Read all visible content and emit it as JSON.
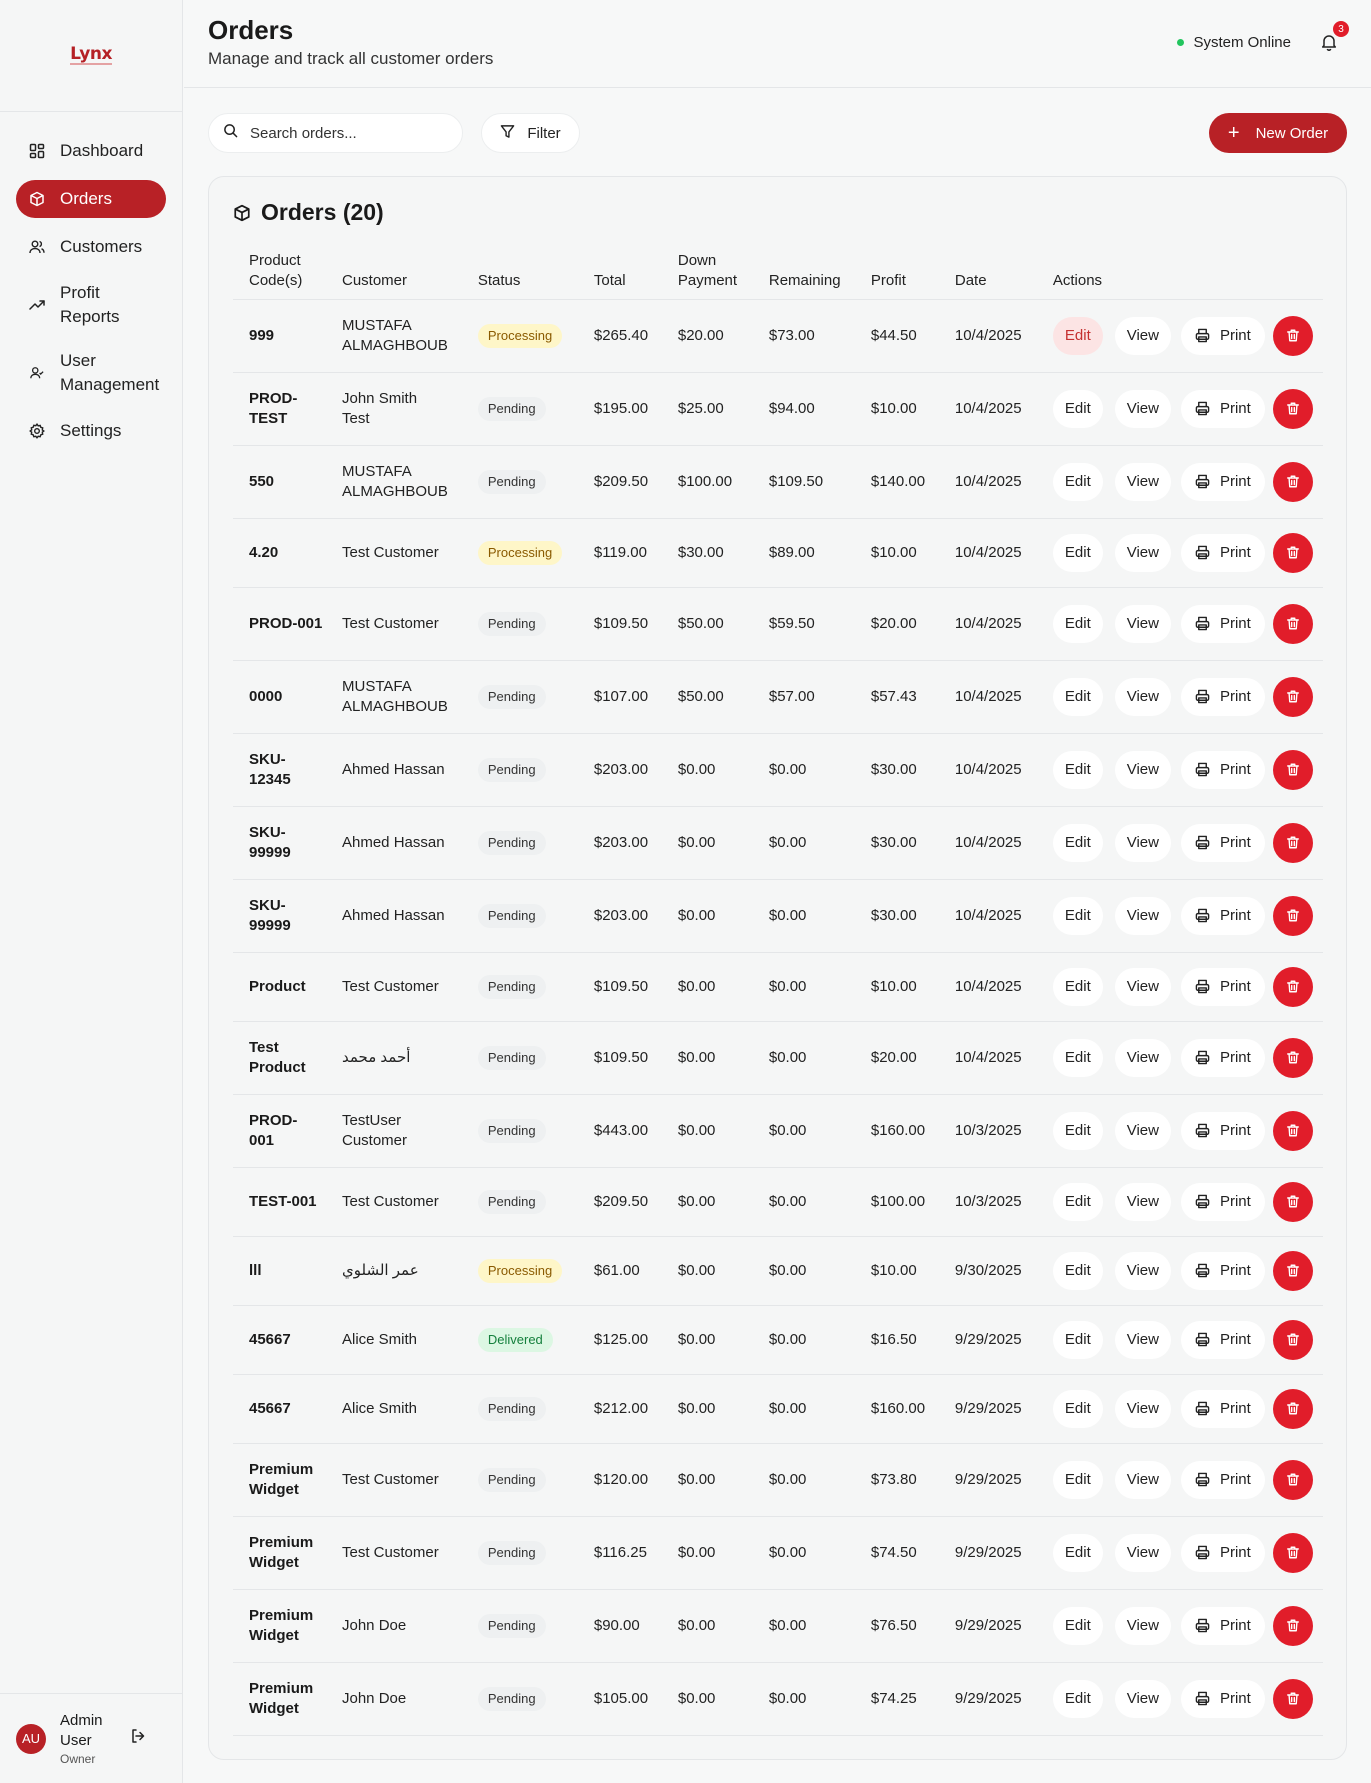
{
  "app": {
    "logo_text": "Lynx"
  },
  "sidebar": {
    "items": [
      {
        "label": "Dashboard",
        "icon": "dashboard-icon",
        "active": false
      },
      {
        "label": "Orders",
        "icon": "package-icon",
        "active": true
      },
      {
        "label": "Customers",
        "icon": "users-icon",
        "active": false
      },
      {
        "label": "Profit\nReports",
        "icon": "trending-up-icon",
        "active": false
      },
      {
        "label": "User\nManagement",
        "icon": "user-management-icon",
        "active": false
      },
      {
        "label": "Settings",
        "icon": "gear-icon",
        "active": false
      }
    ],
    "user": {
      "initials": "AU",
      "name": "Admin\nUser",
      "role": "Owner"
    }
  },
  "header": {
    "title": "Orders",
    "subtitle": "Manage and track all customer orders",
    "system_status": "System Online",
    "notification_count": "3"
  },
  "toolbar": {
    "search_placeholder": "Search orders...",
    "filter_label": "Filter",
    "new_order_label": "New Order"
  },
  "orders": {
    "title": "Orders (20)",
    "columns": [
      "Product\nCode(s)",
      "Customer",
      "Status",
      "Total",
      "Down\nPayment",
      "Remaining",
      "Profit",
      "Date",
      "Actions"
    ],
    "action_labels": {
      "edit": "Edit",
      "view": "View",
      "print": "Print"
    },
    "rows": [
      {
        "code": "999",
        "customer": "MUSTAFA ALMAGHBOUB",
        "status": "Processing",
        "total": "$265.40",
        "down": "$20.00",
        "remaining": "$73.00",
        "profit": "$44.50",
        "date": "10/4/2025"
      },
      {
        "code": "PROD-TEST",
        "customer": "John Smith Test",
        "status": "Pending",
        "total": "$195.00",
        "down": "$25.00",
        "remaining": "$94.00",
        "profit": "$10.00",
        "date": "10/4/2025"
      },
      {
        "code": "550",
        "customer": "MUSTAFA ALMAGHBOUB",
        "status": "Pending",
        "total": "$209.50",
        "down": "$100.00",
        "remaining": "$109.50",
        "profit": "$140.00",
        "date": "10/4/2025"
      },
      {
        "code": "4.20",
        "customer": "Test Customer",
        "status": "Processing",
        "total": "$119.00",
        "down": "$30.00",
        "remaining": "$89.00",
        "profit": "$10.00",
        "date": "10/4/2025"
      },
      {
        "code": "PROD-001",
        "customer": "Test Customer",
        "status": "Pending",
        "total": "$109.50",
        "down": "$50.00",
        "remaining": "$59.50",
        "profit": "$20.00",
        "date": "10/4/2025"
      },
      {
        "code": "0000",
        "customer": "MUSTAFA ALMAGHBOUB",
        "status": "Pending",
        "total": "$107.00",
        "down": "$50.00",
        "remaining": "$57.00",
        "profit": "$57.43",
        "date": "10/4/2025"
      },
      {
        "code": "SKU-12345",
        "customer": "Ahmed Hassan",
        "status": "Pending",
        "total": "$203.00",
        "down": "$0.00",
        "remaining": "$0.00",
        "profit": "$30.00",
        "date": "10/4/2025"
      },
      {
        "code": "SKU-99999",
        "customer": "Ahmed Hassan",
        "status": "Pending",
        "total": "$203.00",
        "down": "$0.00",
        "remaining": "$0.00",
        "profit": "$30.00",
        "date": "10/4/2025"
      },
      {
        "code": "SKU-99999",
        "customer": "Ahmed Hassan",
        "status": "Pending",
        "total": "$203.00",
        "down": "$0.00",
        "remaining": "$0.00",
        "profit": "$30.00",
        "date": "10/4/2025"
      },
      {
        "code": "Product",
        "customer": "Test Customer",
        "status": "Pending",
        "total": "$109.50",
        "down": "$0.00",
        "remaining": "$0.00",
        "profit": "$10.00",
        "date": "10/4/2025"
      },
      {
        "code": "Test Product",
        "customer": "أحمد محمد",
        "status": "Pending",
        "total": "$109.50",
        "down": "$0.00",
        "remaining": "$0.00",
        "profit": "$20.00",
        "date": "10/4/2025"
      },
      {
        "code": "PROD-001",
        "customer": "TestUser Customer",
        "status": "Pending",
        "total": "$443.00",
        "down": "$0.00",
        "remaining": "$0.00",
        "profit": "$160.00",
        "date": "10/3/2025"
      },
      {
        "code": "TEST-001",
        "customer": "Test Customer",
        "status": "Pending",
        "total": "$209.50",
        "down": "$0.00",
        "remaining": "$0.00",
        "profit": "$100.00",
        "date": "10/3/2025"
      },
      {
        "code": "lll",
        "customer": "عمر الشلوي",
        "status": "Processing",
        "total": "$61.00",
        "down": "$0.00",
        "remaining": "$0.00",
        "profit": "$10.00",
        "date": "9/30/2025"
      },
      {
        "code": "45667",
        "customer": "Alice Smith",
        "status": "Delivered",
        "total": "$125.00",
        "down": "$0.00",
        "remaining": "$0.00",
        "profit": "$16.50",
        "date": "9/29/2025"
      },
      {
        "code": "45667",
        "customer": "Alice Smith",
        "status": "Pending",
        "total": "$212.00",
        "down": "$0.00",
        "remaining": "$0.00",
        "profit": "$160.00",
        "date": "9/29/2025"
      },
      {
        "code": "Premium Widget",
        "customer": "Test Customer",
        "status": "Pending",
        "total": "$120.00",
        "down": "$0.00",
        "remaining": "$0.00",
        "profit": "$73.80",
        "date": "9/29/2025"
      },
      {
        "code": "Premium Widget",
        "customer": "Test Customer",
        "status": "Pending",
        "total": "$116.25",
        "down": "$0.00",
        "remaining": "$0.00",
        "profit": "$74.50",
        "date": "9/29/2025"
      },
      {
        "code": "Premium Widget",
        "customer": "John Doe",
        "status": "Pending",
        "total": "$90.00",
        "down": "$0.00",
        "remaining": "$0.00",
        "profit": "$76.50",
        "date": "9/29/2025"
      },
      {
        "code": "Premium Widget",
        "customer": "John Doe",
        "status": "Pending",
        "total": "$105.00",
        "down": "$0.00",
        "remaining": "$0.00",
        "profit": "$74.25",
        "date": "9/29/2025"
      }
    ]
  },
  "colors": {
    "brand": "#b82126",
    "delete": "#e11d2a",
    "online": "#22c55e"
  }
}
